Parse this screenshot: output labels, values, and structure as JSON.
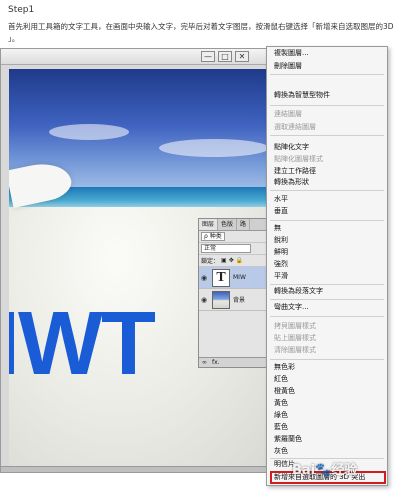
{
  "step": {
    "title": "Step1",
    "line1": "首先利用工具箱的文字工具，在画面中央输入文字，完毕后对着文字图层，按滑鼠右键选择「新增来自选取图层的3D",
    "line2": "」。"
  },
  "window": {
    "buttons": [
      "—",
      "□",
      "✕"
    ]
  },
  "canvas": {
    "text": "IWT"
  },
  "layers_panel": {
    "tabs": [
      "图层",
      "色版",
      "路"
    ],
    "filter_label": "ρ 种类",
    "blend_mode": "正常",
    "lock_label": "鎖定：",
    "layers": [
      {
        "kind": "text",
        "name": "MIW"
      },
      {
        "kind": "image",
        "name": "背景"
      }
    ],
    "footer_icons": [
      "∞",
      "fx."
    ]
  },
  "context_menu": {
    "items": [
      {
        "label": "複製圖層...",
        "enabled": true
      },
      {
        "label": "刪除圖層",
        "enabled": true
      },
      {
        "label": "轉換為智慧型物件",
        "enabled": true
      },
      {
        "label": "連結圖層",
        "enabled": false
      },
      {
        "label": "選取連結圖層",
        "enabled": false
      },
      {
        "label": "點陣化文字",
        "enabled": true
      },
      {
        "label": "點陣化圖層樣式",
        "enabled": false
      },
      {
        "label": "建立工作路徑",
        "enabled": true
      },
      {
        "label": "轉換為形狀",
        "enabled": true
      },
      {
        "label": "水平",
        "enabled": true
      },
      {
        "label": "垂直",
        "enabled": true
      },
      {
        "label": "無",
        "enabled": true
      },
      {
        "label": "銳利",
        "enabled": true
      },
      {
        "label": "鮮明",
        "enabled": true
      },
      {
        "label": "強烈",
        "enabled": true
      },
      {
        "label": "平滑",
        "enabled": true
      },
      {
        "label": "轉換為段落文字",
        "enabled": true
      },
      {
        "label": "彎曲文字...",
        "enabled": true
      },
      {
        "label": "拷貝圖層樣式",
        "enabled": false
      },
      {
        "label": "貼上圖層樣式",
        "enabled": false
      },
      {
        "label": "清除圖層樣式",
        "enabled": false
      },
      {
        "label": "無色彩",
        "enabled": true
      },
      {
        "label": "紅色",
        "enabled": true
      },
      {
        "label": "橙黃色",
        "enabled": true
      },
      {
        "label": "黃色",
        "enabled": true
      },
      {
        "label": "綠色",
        "enabled": true
      },
      {
        "label": "藍色",
        "enabled": true
      },
      {
        "label": "紫羅蘭色",
        "enabled": true
      },
      {
        "label": "灰色",
        "enabled": true
      },
      {
        "label": "明信片",
        "enabled": true
      },
      {
        "label": "新增來自選取圖層的 3D 突出",
        "enabled": true
      }
    ]
  },
  "watermark": {
    "text": "Bai",
    "paw": "🐾",
    "suffix": "经验"
  },
  "colors": {
    "highlight": "#d01c1c",
    "text_blue": "#1a5bd6"
  }
}
